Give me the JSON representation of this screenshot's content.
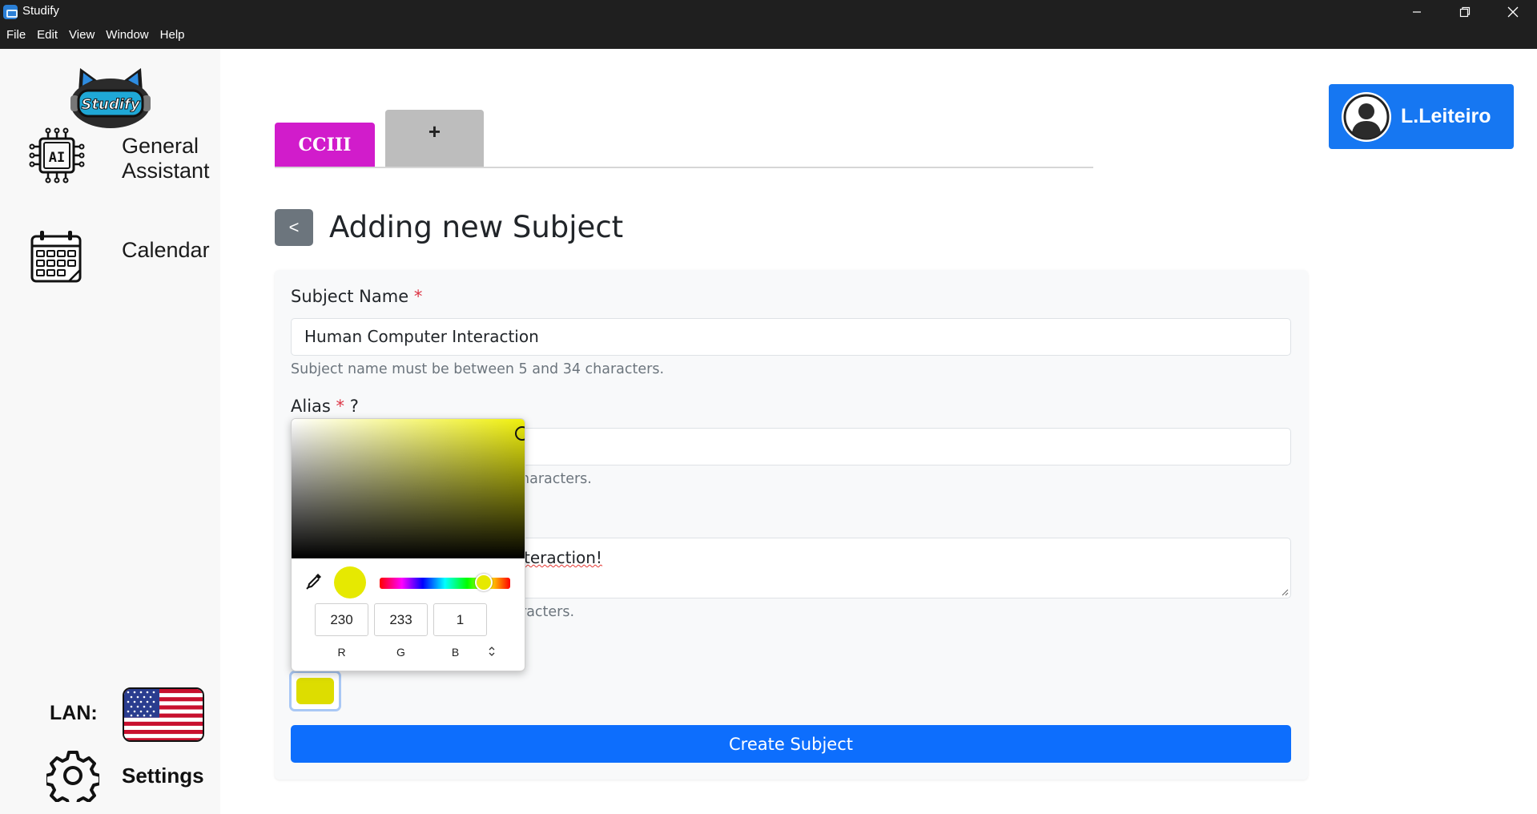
{
  "window": {
    "title": "Studify",
    "menu": [
      "File",
      "Edit",
      "View",
      "Window",
      "Help"
    ]
  },
  "sidebar": {
    "logo_text": "Studify",
    "items": [
      {
        "label_line1": "General",
        "label_line2": "Assistant",
        "icon": "ai-chip-icon"
      },
      {
        "label_line1": "Calendar",
        "label_line2": "",
        "icon": "calendar-icon"
      }
    ],
    "lan_label": "LAN:",
    "language_flag": "us-flag-icon",
    "settings_label": "Settings"
  },
  "tabs": {
    "active_label": "CCIII",
    "add_label": "+"
  },
  "user": {
    "name": "L.Leiteiro"
  },
  "header": {
    "back_label": "<",
    "title": "Adding new Subject"
  },
  "form": {
    "subject_name": {
      "label": "Subject Name",
      "required_mark": "*",
      "value": "Human Computer Interaction",
      "help": "Subject name must be between 5 and 34 characters."
    },
    "alias": {
      "label": "Alias",
      "required_mark": "*",
      "hint_mark": "?",
      "value": "",
      "help_visible": "haracters."
    },
    "description": {
      "value_visible": "teraction!",
      "help_visible": "racters."
    },
    "color": {
      "selected_hex": "#e6e901",
      "swatch_hex": "#dddd00"
    },
    "submit_label": "Create Subject"
  },
  "color_picker": {
    "r": "230",
    "g": "233",
    "b": "1",
    "r_label": "R",
    "g_label": "G",
    "b_label": "B",
    "hue_hex": "#f0f00a"
  },
  "colors": {
    "accent_blue": "#0d6efd",
    "user_button": "#1677f2",
    "tab_active": "#d11ccb",
    "tab_add": "#bdbdbd",
    "back_button": "#6c757d",
    "required": "#dc3545"
  }
}
